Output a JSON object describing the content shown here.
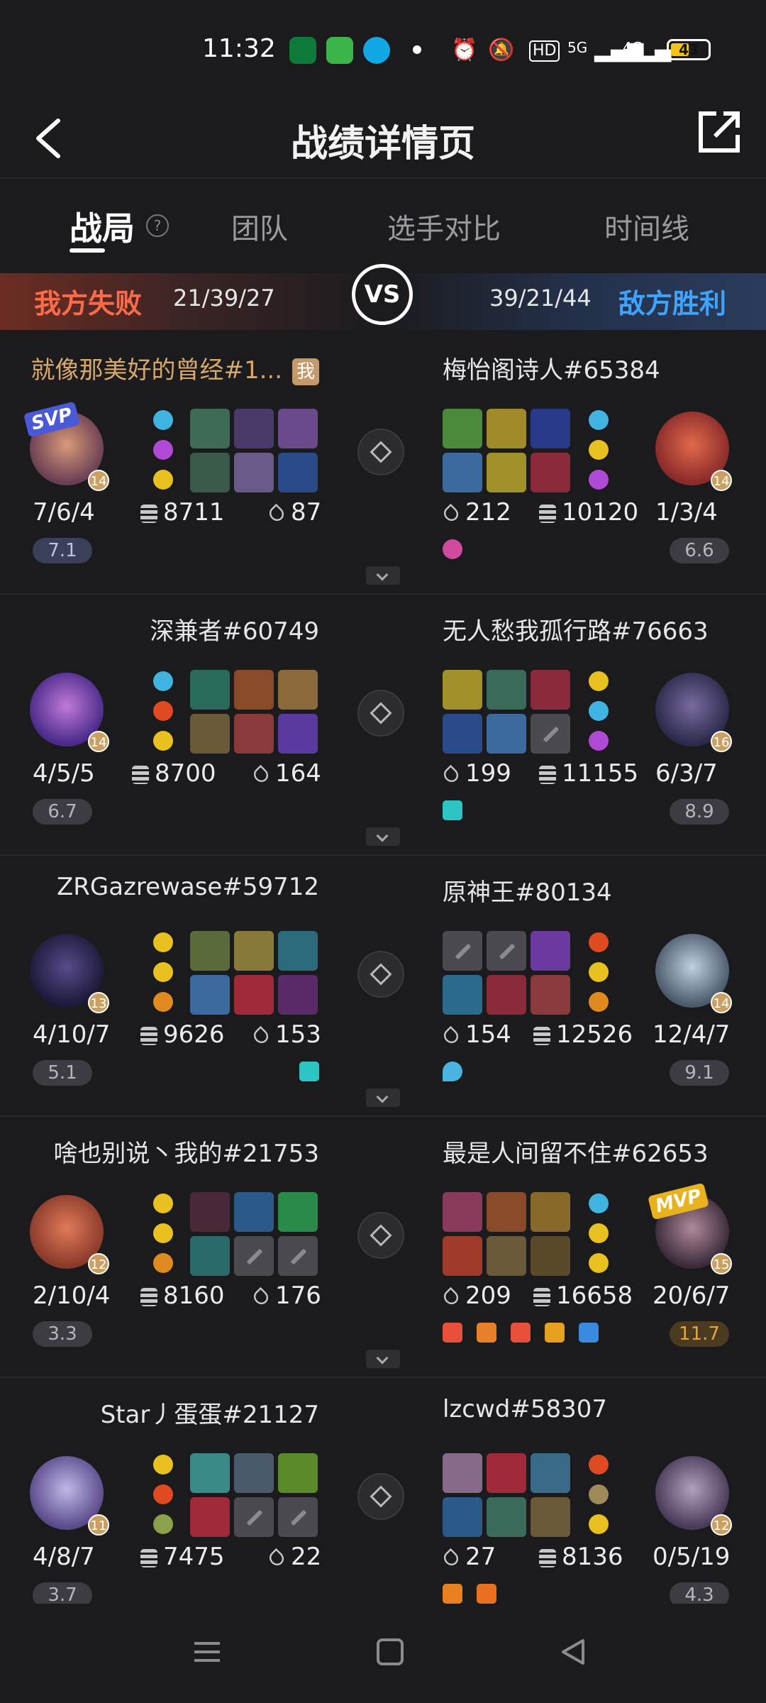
{
  "status_bar": {
    "time": "11:32",
    "battery": "43",
    "network": "5G",
    "network2": "4G",
    "hd": "HD"
  },
  "header": {
    "title": "战绩详情页"
  },
  "tabs": [
    {
      "label": "战局"
    },
    {
      "label": "团队"
    },
    {
      "label": "选手对比"
    },
    {
      "label": "时间线"
    }
  ],
  "help_symbol": "?",
  "result": {
    "my_result": "我方失败",
    "my_kda": "21/39/27",
    "vs": "VS",
    "enemy_kda": "39/21/44",
    "enemy_result": "敌方胜利"
  },
  "me_badge": "我",
  "players": [
    {
      "left": {
        "name": "就像那美好的曾经#1...",
        "level": "14",
        "kda": "7/6/4",
        "gold": "8711",
        "damage": "87",
        "score": "7.1",
        "badge": "SVP"
      },
      "right": {
        "name": "梅怡阁诗人#65384",
        "level": "14",
        "kda": "1/3/4",
        "gold": "10120",
        "damage": "212",
        "score": "6.6"
      }
    },
    {
      "left": {
        "name": "深兼者#60749",
        "level": "14",
        "kda": "4/5/5",
        "gold": "8700",
        "damage": "164",
        "score": "6.7"
      },
      "right": {
        "name": "无人愁我孤行路#76663",
        "level": "16",
        "kda": "6/3/7",
        "gold": "11155",
        "damage": "199",
        "score": "8.9"
      }
    },
    {
      "left": {
        "name": "ZRGazrewase#59712",
        "level": "13",
        "kda": "4/10/7",
        "gold": "9626",
        "damage": "153",
        "score": "5.1"
      },
      "right": {
        "name": "原神王#80134",
        "level": "14",
        "kda": "12/4/7",
        "gold": "12526",
        "damage": "154",
        "score": "9.1"
      }
    },
    {
      "left": {
        "name": "啥也别说丶我的#21753",
        "level": "12",
        "kda": "2/10/4",
        "gold": "8160",
        "damage": "176",
        "score": "3.3"
      },
      "right": {
        "name": "最是人间留不住#62653",
        "level": "15",
        "kda": "20/6/7",
        "gold": "16658",
        "damage": "209",
        "score": "11.7",
        "badge": "MVP"
      }
    },
    {
      "left": {
        "name": "Star丿蛋蛋#21127",
        "level": "11",
        "kda": "4/8/7",
        "gold": "7475",
        "damage": "22",
        "score": "3.7"
      },
      "right": {
        "name": "lzcwd#58307",
        "level": "12",
        "kda": "0/5/19",
        "gold": "8136",
        "damage": "27",
        "score": "4.3"
      }
    }
  ]
}
